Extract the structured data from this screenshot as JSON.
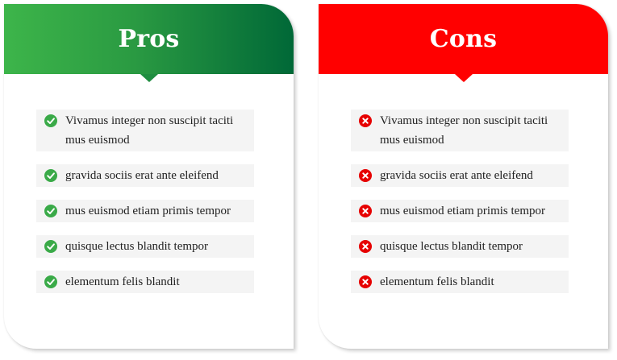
{
  "pros": {
    "title": "Pros",
    "icon": "check-circle-icon",
    "accent_start": "#3db54a",
    "accent_end": "#006837",
    "items": [
      "Vivamus integer non suscipit taciti mus euismod",
      "gravida sociis erat ante eleifend",
      "mus euismod etiam primis tempor",
      "quisque lectus blandit tempor",
      "elementum felis blandit"
    ]
  },
  "cons": {
    "title": "Cons",
    "icon": "x-circle-icon",
    "accent": "#ff0000",
    "items": [
      "Vivamus integer non suscipit taciti mus euismod",
      "gravida sociis erat ante eleifend",
      "mus euismod etiam primis tempor",
      "quisque lectus blandit tempor",
      "elementum felis blandit"
    ]
  }
}
